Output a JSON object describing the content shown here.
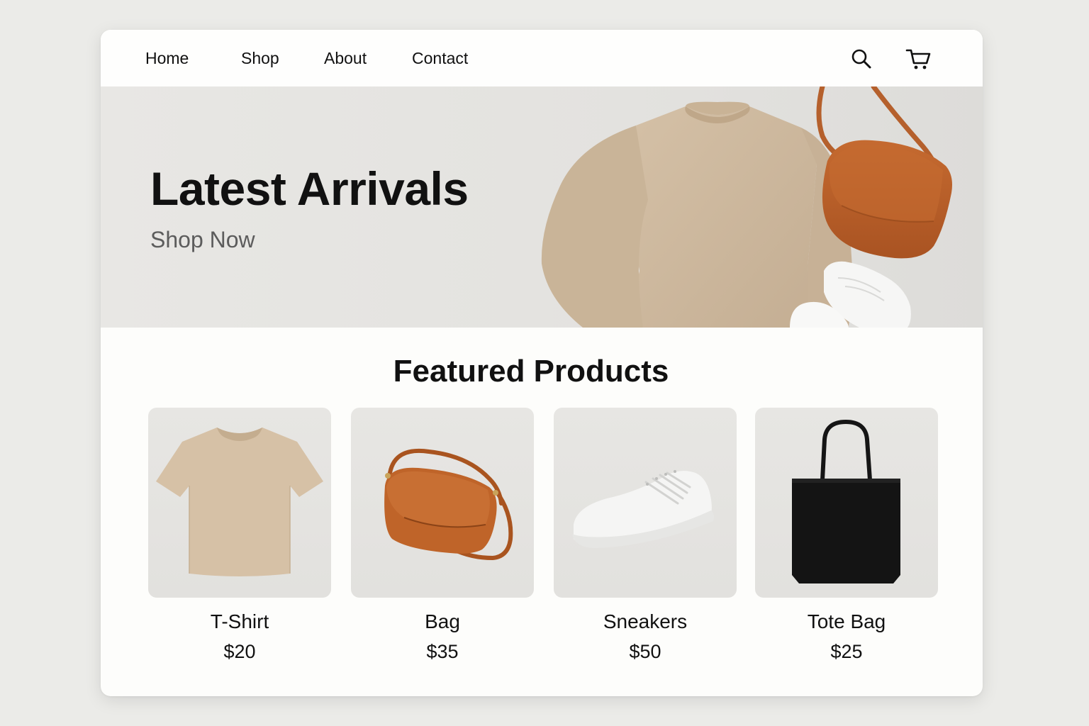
{
  "nav": {
    "links": [
      {
        "label": "Home"
      },
      {
        "label": "Shop"
      },
      {
        "label": "About"
      },
      {
        "label": "Contact"
      }
    ],
    "icons": [
      "search-icon",
      "cart-icon"
    ]
  },
  "hero": {
    "title": "Latest Arrivals",
    "cta": "Shop Now"
  },
  "featured": {
    "title": "Featured Products",
    "products": [
      {
        "name": "T-Shirt",
        "price": "$20",
        "image": "tshirt-image"
      },
      {
        "name": "Bag",
        "price": "$35",
        "image": "bag-image"
      },
      {
        "name": "Sneakers",
        "price": "$50",
        "image": "sneakers-image"
      },
      {
        "name": "Tote Bag",
        "price": "$25",
        "image": "tote-bag-image"
      }
    ]
  },
  "colors": {
    "page_bg": "#ebebe8",
    "card_bg": "#fdfdfb",
    "text": "#111111",
    "muted_text": "#5c5c5c",
    "tan": "#cdb89f",
    "leather": "#b8612b",
    "tote": "#141414"
  }
}
